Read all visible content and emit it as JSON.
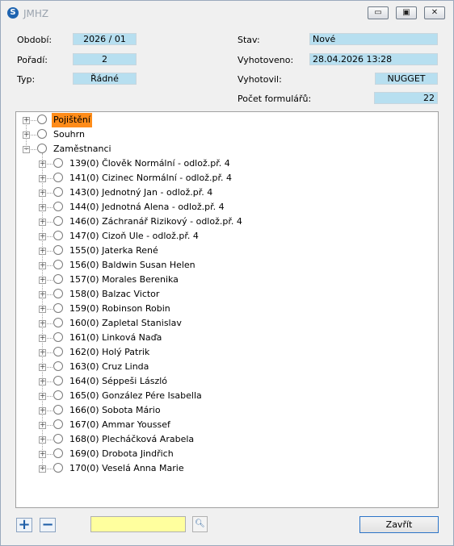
{
  "window": {
    "title": "JMHZ",
    "icon": "S"
  },
  "form": {
    "obdobi_label": "Období:",
    "obdobi_value": "2026 / 01",
    "poradi_label": "Pořadí:",
    "poradi_value": "2",
    "typ_label": "Typ:",
    "typ_value": "Řádné",
    "stav_label": "Stav:",
    "stav_value": "Nové",
    "vyhotoveno_label": "Vyhotoveno:",
    "vyhotoveno_value": "28.04.2026 13:28",
    "vyhotovil_label": "Vyhotovil:",
    "vyhotovil_value": "NUGGET",
    "pocet_label": "Počet formulářů:",
    "pocet_value": "22"
  },
  "tree": {
    "roots": [
      {
        "label": "Pojištění",
        "expander": "+",
        "selected": true
      },
      {
        "label": "Souhrn",
        "expander": "+",
        "selected": false
      },
      {
        "label": "Zaměstnanci",
        "expander": "−",
        "selected": false
      }
    ],
    "employees": [
      "139(0) Člověk Normální - odlož.př. 4",
      "141(0) Cizinec Normální - odlož.př. 4",
      "143(0) Jednotný Jan - odlož.př. 4",
      "144(0) Jednotná Alena - odlož.př. 4",
      "146(0) Záchranář Rizikový - odlož.př. 4",
      "147(0) Cizoň Ule - odlož.př. 4",
      "155(0) Jaterka René",
      "156(0) Baldwin Susan Helen",
      "157(0) Morales Berenika",
      "158(0) Balzac Victor",
      "159(0) Robinson Robin",
      "160(0) Zapletal Stanislav",
      "161(0) Linková Naďa",
      "162(0) Holý Patrik",
      "163(0) Cruz Linda",
      "164(0) Séppeši László",
      "165(0) González Pére Isabella",
      "166(0) Sobota Mário",
      "167(0) Ammar Youssef",
      "168(0) Plecháčková Arabela",
      "169(0) Drobota Jindřich",
      "170(0) Veselá Anna Marie"
    ]
  },
  "footer": {
    "add_symbol": "+",
    "remove_symbol": "−",
    "filter_value": "",
    "close_label": "Zavřít"
  },
  "colors": {
    "field_bg": "#b7dff0",
    "selected_bg": "#ff8c1a",
    "filter_bg": "#ffff9e"
  }
}
